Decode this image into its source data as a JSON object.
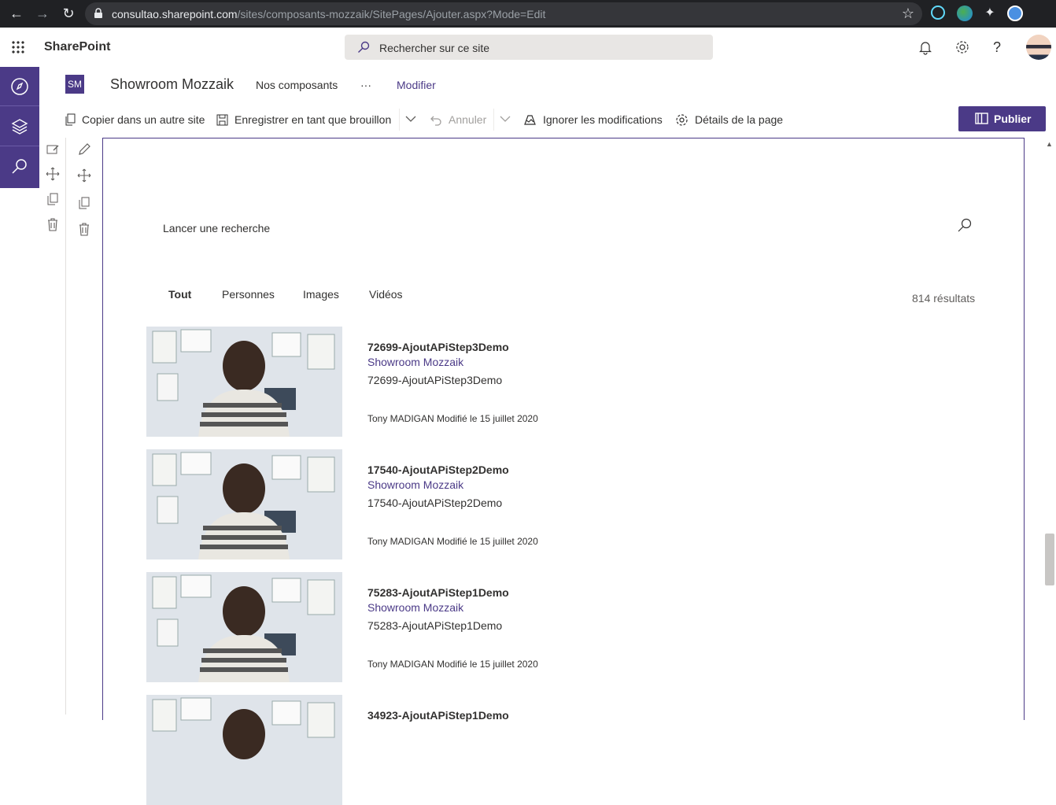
{
  "browser": {
    "url_host": "consultao.sharepoint.com",
    "url_path": "/sites/composants-mozzaik/SitePages/Ajouter.aspx?Mode=Edit"
  },
  "suite": {
    "app_name": "SharePoint",
    "search_placeholder": "Rechercher sur ce site"
  },
  "site": {
    "logo_initials": "SM",
    "title": "Showroom Mozzaik",
    "nav": [
      "Nos composants",
      "···",
      "Modifier"
    ]
  },
  "commandbar": {
    "copy": "Copier dans un autre site",
    "save_draft": "Enregistrer en tant que brouillon",
    "undo": "Annuler",
    "discard": "Ignorer les modifications",
    "page_details": "Détails de la page",
    "publish": "Publier"
  },
  "search_webpart": {
    "placeholder": "Lancer une recherche",
    "tabs": [
      "Tout",
      "Personnes",
      "Images",
      "Vidéos"
    ],
    "active_tab": "Tout",
    "result_count": "814 résultats",
    "results": [
      {
        "title": "72699-AjoutAPiStep3Demo",
        "site": "Showroom Mozzaik",
        "description": "72699-AjoutAPiStep3Demo",
        "meta": "Tony MADIGAN Modifié le 15 juillet 2020"
      },
      {
        "title": "17540-AjoutAPiStep2Demo",
        "site": "Showroom Mozzaik",
        "description": "17540-AjoutAPiStep2Demo",
        "meta": "Tony MADIGAN Modifié le 15 juillet 2020"
      },
      {
        "title": "75283-AjoutAPiStep1Demo",
        "site": "Showroom Mozzaik",
        "description": "75283-AjoutAPiStep1Demo",
        "meta": "Tony MADIGAN Modifié le 15 juillet 2020"
      },
      {
        "title": "34923-AjoutAPiStep1Demo",
        "site": "",
        "description": "",
        "meta": ""
      }
    ]
  },
  "colors": {
    "accent": "#4b3a87",
    "chrome_bg": "#202124"
  }
}
